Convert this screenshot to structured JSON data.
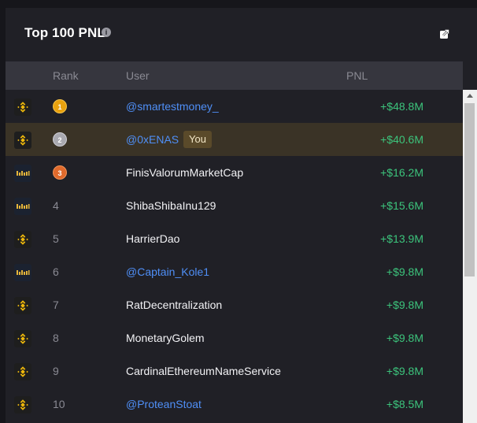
{
  "header": {
    "title": "Top 100 PNL",
    "info_icon": "info-icon",
    "share_icon": "share-icon"
  },
  "columns": {
    "rank": "Rank",
    "user": "User",
    "pnl": "PNL"
  },
  "colors": {
    "pnl_positive": "#3cc47c",
    "link": "#4f8ff7",
    "highlight_row": "#3a3326",
    "gold": "#e9a20f",
    "silver": "#a9a9b0",
    "bronze": "#e06a2c"
  },
  "you_label": "You",
  "rows": [
    {
      "exchange": "binance",
      "rank": "1",
      "user": "@smartestmoney_",
      "pnl": "+$48.8M"
    },
    {
      "exchange": "binance",
      "rank": "2",
      "user": "@0xENAS",
      "pnl": "+$40.6M"
    },
    {
      "exchange": "bybit",
      "rank": "3",
      "user": "FinisValorumMarketCap",
      "pnl": "+$16.2M"
    },
    {
      "exchange": "bybit",
      "rank": "4",
      "user": "ShibaShibaInu129",
      "pnl": "+$15.6M"
    },
    {
      "exchange": "binance",
      "rank": "5",
      "user": "HarrierDao",
      "pnl": "+$13.9M"
    },
    {
      "exchange": "bybit",
      "rank": "6",
      "user": "@Captain_Kole1",
      "pnl": "+$9.8M"
    },
    {
      "exchange": "binance",
      "rank": "7",
      "user": "RatDecentralization",
      "pnl": "+$9.8M"
    },
    {
      "exchange": "binance",
      "rank": "8",
      "user": "MonetaryGolem",
      "pnl": "+$9.8M"
    },
    {
      "exchange": "binance",
      "rank": "9",
      "user": "CardinalEthereumNameService",
      "pnl": "+$9.8M"
    },
    {
      "exchange": "binance",
      "rank": "10",
      "user": "@ProteanStoat",
      "pnl": "+$8.5M"
    }
  ]
}
